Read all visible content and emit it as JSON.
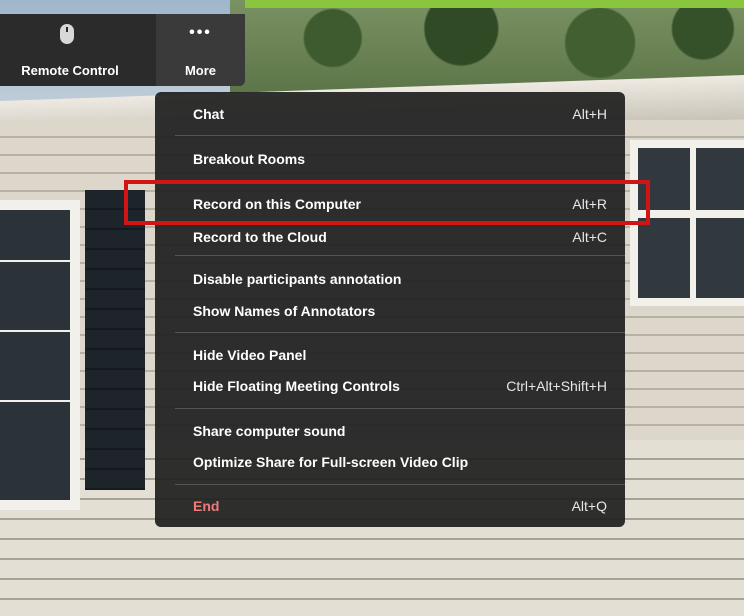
{
  "toolbar": {
    "remote_control_label": "Remote Control",
    "more_label": "More"
  },
  "menu": {
    "items": [
      {
        "label": "Chat",
        "shortcut": "Alt+H"
      },
      {
        "label": "Breakout Rooms",
        "shortcut": ""
      },
      {
        "label": "Record on this Computer",
        "shortcut": "Alt+R"
      },
      {
        "label": "Record to the Cloud",
        "shortcut": "Alt+C"
      },
      {
        "label": "Disable participants annotation",
        "shortcut": ""
      },
      {
        "label": "Show Names of Annotators",
        "shortcut": ""
      },
      {
        "label": "Hide Video Panel",
        "shortcut": ""
      },
      {
        "label": "Hide Floating Meeting Controls",
        "shortcut": "Ctrl+Alt+Shift+H"
      },
      {
        "label": "Share computer sound",
        "shortcut": ""
      },
      {
        "label": "Optimize Share for Full-screen Video Clip",
        "shortcut": ""
      },
      {
        "label": "End",
        "shortcut": "Alt+Q"
      }
    ]
  },
  "colors": {
    "highlight_border": "#d11414",
    "end_text": "#ef7b7b",
    "accent_bar": "#8ac53e"
  }
}
